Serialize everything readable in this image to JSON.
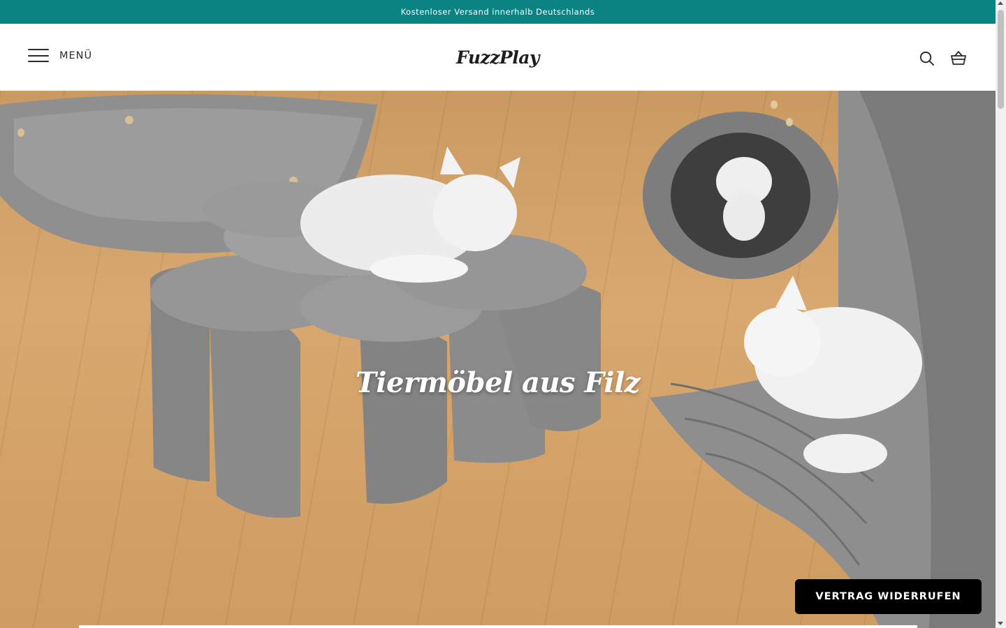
{
  "announcement": {
    "text": "Kostenloser Versand innerhalb Deutschlands",
    "background": "#0b8383"
  },
  "header": {
    "menu_label": "MENÜ",
    "logo_text": "FuzzPlay",
    "icons": [
      "search-icon",
      "cart-icon"
    ]
  },
  "hero": {
    "title": "Tiermöbel aus Filz",
    "image": "cats-on-felt-pet-furniture"
  },
  "floating": {
    "withdraw_label": "VERTRAG WIDERRUFEN"
  }
}
